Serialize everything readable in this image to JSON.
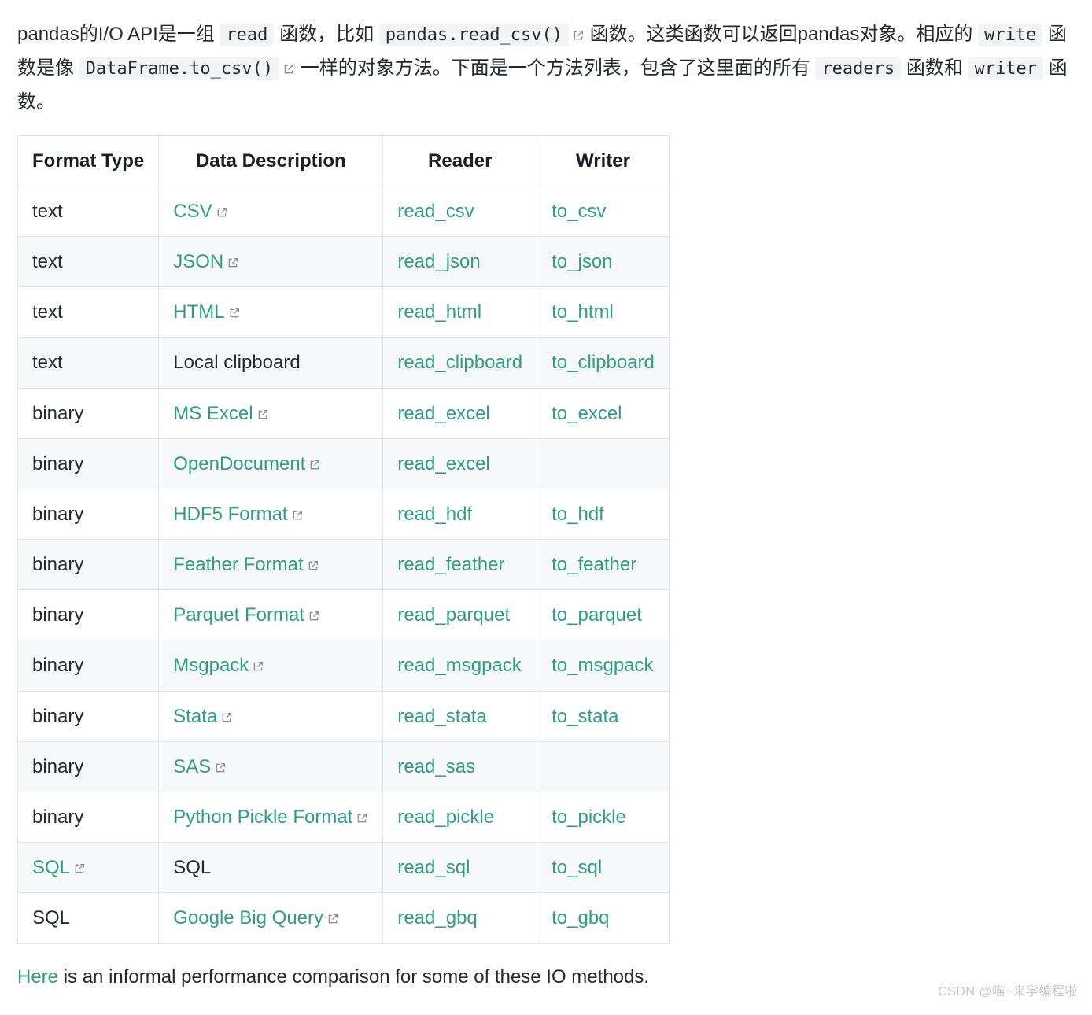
{
  "intro": {
    "p1_a": "pandas的I/O API是一组 ",
    "code_read": "read",
    "p1_b": " 函数，比如 ",
    "code_readcsv": "pandas.read_csv()",
    "p1_c": "函数。这类函数可以返回pandas对象。相应的 ",
    "code_write": "write",
    "p1_d": " 函数是像 ",
    "code_tocsv": "DataFrame.to_csv()",
    "p1_e": "一样的对象方法。下面是一个方法列表，包含了这里面的所有 ",
    "code_readers": "readers",
    "p1_f": " 函数和 ",
    "code_writer": "writer",
    "p1_g": " 函数。"
  },
  "table": {
    "headers": [
      "Format Type",
      "Data Description",
      "Reader",
      "Writer"
    ],
    "rows": [
      {
        "ftype": "text",
        "ftype_link": false,
        "desc": "CSV",
        "desc_link": true,
        "reader": "read_csv",
        "writer": "to_csv"
      },
      {
        "ftype": "text",
        "ftype_link": false,
        "desc": "JSON",
        "desc_link": true,
        "reader": "read_json",
        "writer": "to_json"
      },
      {
        "ftype": "text",
        "ftype_link": false,
        "desc": "HTML",
        "desc_link": true,
        "reader": "read_html",
        "writer": "to_html"
      },
      {
        "ftype": "text",
        "ftype_link": false,
        "desc": "Local clipboard",
        "desc_link": false,
        "reader": "read_clipboard",
        "writer": "to_clipboard"
      },
      {
        "ftype": "binary",
        "ftype_link": false,
        "desc": "MS Excel",
        "desc_link": true,
        "reader": "read_excel",
        "writer": "to_excel"
      },
      {
        "ftype": "binary",
        "ftype_link": false,
        "desc": "OpenDocument",
        "desc_link": true,
        "reader": "read_excel",
        "writer": ""
      },
      {
        "ftype": "binary",
        "ftype_link": false,
        "desc": "HDF5 Format",
        "desc_link": true,
        "reader": "read_hdf",
        "writer": "to_hdf"
      },
      {
        "ftype": "binary",
        "ftype_link": false,
        "desc": "Feather Format",
        "desc_link": true,
        "reader": "read_feather",
        "writer": "to_feather"
      },
      {
        "ftype": "binary",
        "ftype_link": false,
        "desc": "Parquet Format",
        "desc_link": true,
        "reader": "read_parquet",
        "writer": "to_parquet"
      },
      {
        "ftype": "binary",
        "ftype_link": false,
        "desc": "Msgpack",
        "desc_link": true,
        "reader": "read_msgpack",
        "writer": "to_msgpack"
      },
      {
        "ftype": "binary",
        "ftype_link": false,
        "desc": "Stata",
        "desc_link": true,
        "reader": "read_stata",
        "writer": "to_stata"
      },
      {
        "ftype": "binary",
        "ftype_link": false,
        "desc": "SAS",
        "desc_link": true,
        "reader": "read_sas",
        "writer": ""
      },
      {
        "ftype": "binary",
        "ftype_link": false,
        "desc": "Python Pickle Format",
        "desc_link": true,
        "reader": "read_pickle",
        "writer": "to_pickle"
      },
      {
        "ftype": "SQL",
        "ftype_link": true,
        "desc": "SQL",
        "desc_link": false,
        "reader": "read_sql",
        "writer": "to_sql"
      },
      {
        "ftype": "SQL",
        "ftype_link": false,
        "desc": "Google Big Query",
        "desc_link": true,
        "reader": "read_gbq",
        "writer": "to_gbq"
      }
    ]
  },
  "footer": {
    "here": "Here",
    "rest": " is an informal performance comparison for some of these IO methods."
  },
  "watermark": "CSDN @喵~来学编程啦"
}
